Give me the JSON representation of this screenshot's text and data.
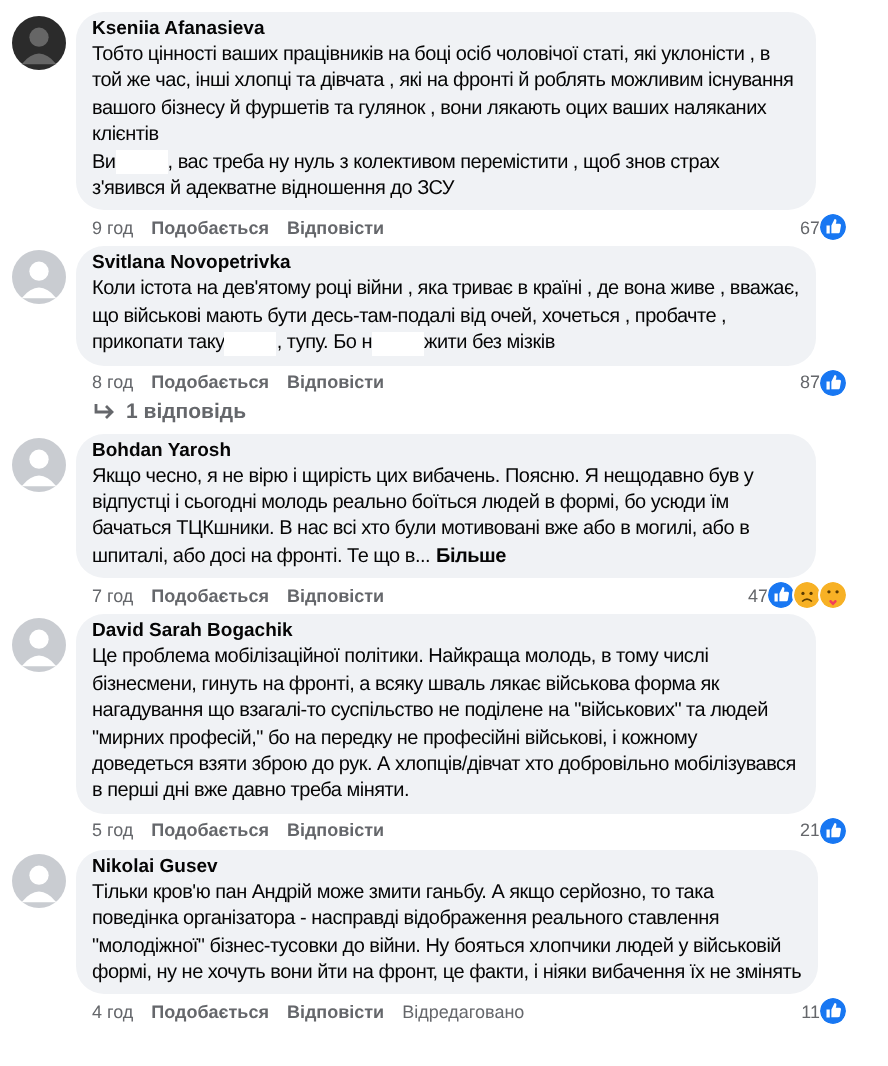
{
  "comments": [
    {
      "author": "Kseniia Afanasieva",
      "lines": [
        [
          {
            "kind": "text",
            "text": "Тобто цінності ваших працівників на боці осіб чоловічої статі, які уклоністи , в"
          }
        ],
        [
          {
            "kind": "text",
            "text": "той же час, інші хлопці та дівчата , які на фронті й роблять можливим існування"
          }
        ],
        [
          {
            "kind": "text",
            "text": "вашого бізнесу й фуршетів та гулянок , вони лякають оцих ваших наляканих"
          }
        ],
        [
          {
            "kind": "text",
            "text": "клієнтів"
          }
        ],
        [
          {
            "kind": "text",
            "text": "Ви"
          },
          {
            "kind": "redaction"
          },
          {
            "kind": "text",
            "text": ", вас треба ну нуль з колективом перемістити , щоб знов страх"
          }
        ],
        [
          {
            "kind": "text",
            "text": "з'явився й адекватне відношення до ЗСУ"
          }
        ]
      ],
      "time": "9 год",
      "actions": [
        "Подобається",
        "Відповісти"
      ],
      "reaction_count": "67",
      "reactions": [
        {
          "kind": "like"
        }
      ]
    },
    {
      "author": "Svitlana Novopetrivka",
      "lines": [
        [
          {
            "kind": "text",
            "text": "Коли істота на дев'ятому році війни , яка триває в країні , де вона живе , вважає,"
          }
        ],
        [
          {
            "kind": "text",
            "text": "що військові мають бути десь-там-подалі від очей, хочеться , пробачте ,"
          }
        ],
        [
          {
            "kind": "text",
            "text": "прикопати таку"
          },
          {
            "kind": "redaction"
          },
          {
            "kind": "text",
            "text": ", тупу. Бо н"
          },
          {
            "kind": "redaction"
          },
          {
            "kind": "text",
            "text": "жити без мізків"
          }
        ]
      ],
      "time": "8 год",
      "actions": [
        "Подобається",
        "Відповісти"
      ],
      "reaction_count": "87",
      "reactions": [
        {
          "kind": "like"
        }
      ],
      "replies_link": "1 відповідь"
    },
    {
      "author": "Bohdan Yarosh",
      "lines": [
        [
          {
            "kind": "text",
            "text": "Якщо чесно, я не вірю і щирість цих вибачень. Поясню. Я нещодавно був у"
          }
        ],
        [
          {
            "kind": "text",
            "text": "відпустці і сьогодні молодь реально боїться людей в формі, бо усюди їм"
          }
        ],
        [
          {
            "kind": "text",
            "text": "бачаться ТЦКшники. В нас всі хто були мотивовані вже або в могилі, або в"
          }
        ],
        [
          {
            "kind": "text",
            "text": "шпиталі, або досі на фронті. Те що в..."
          },
          {
            "kind": "more",
            "text": "Більше"
          }
        ]
      ],
      "time": "7 год",
      "actions": [
        "Подобається",
        "Відповісти"
      ],
      "reaction_count": "47",
      "reactions": [
        {
          "kind": "like"
        },
        {
          "kind": "sad"
        },
        {
          "kind": "care"
        }
      ]
    },
    {
      "author": "David Sarah Bogachik",
      "lines": [
        [
          {
            "kind": "text",
            "text": "Це проблема мобілізаційної політики. Найкраща молодь, в тому числі"
          }
        ],
        [
          {
            "kind": "text",
            "text": "бізнесмени, гинуть на фронті, а всяку шваль лякає військова форма як"
          }
        ],
        [
          {
            "kind": "text",
            "text": "нагадування що взагалі-то суспільство не поділене на \"військових\" та людей"
          }
        ],
        [
          {
            "kind": "text",
            "text": "\"мирних професій,\" бо на передку не професійні військові, і кожному"
          }
        ],
        [
          {
            "kind": "text",
            "text": "доведеться взяти зброю до рук. А хлопців/дівчат хто добровільно мобілізувався"
          }
        ],
        [
          {
            "kind": "text",
            "text": "в перші дні вже давно треба міняти."
          }
        ]
      ],
      "time": "5 год",
      "actions": [
        "Подобається",
        "Відповісти"
      ],
      "reaction_count": "21",
      "reactions": [
        {
          "kind": "like"
        }
      ]
    },
    {
      "author": "Nikolai Gusev",
      "lines": [
        [
          {
            "kind": "text",
            "text": "Тільки кров'ю пан Андрій може змити ганьбу. А якщо серйозно, то така"
          }
        ],
        [
          {
            "kind": "text",
            "text": "поведінка організатора - насправді відображення реального ставлення"
          }
        ],
        [
          {
            "kind": "text",
            "text": "\"молодіжної\" бізнес-тусовки до війни. Ну бояться хлопчики людей у військовій"
          }
        ],
        [
          {
            "kind": "text",
            "text": "формі, ну не хочуть вони йти на фронт, це факти, і ніяки вибачення їх не змінять"
          }
        ]
      ],
      "time": "4 год",
      "actions": [
        "Подобається",
        "Відповісти"
      ],
      "edited": "Відредаговано",
      "reaction_count": "11",
      "reactions": [
        {
          "kind": "like"
        }
      ]
    }
  ]
}
